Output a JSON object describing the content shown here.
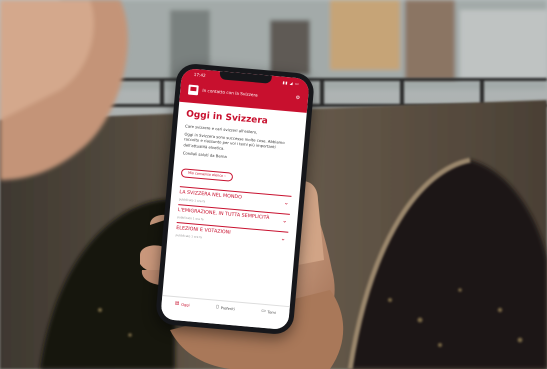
{
  "colors": {
    "brand": "#c8102e",
    "brand_light": "#ffffff",
    "text": "#333333"
  },
  "status": {
    "time": "17:42"
  },
  "header": {
    "title": "In contatto con la Svizzera",
    "logo_icon": "swissinfo-logo",
    "menu_icon": "settings-icon"
  },
  "main": {
    "title": "Oggi in Svizzera",
    "paragraphs": [
      "Care svizzere e cari svizzeri all'estero,",
      "Oggi in Svizzera sono successe molte cose. Abbiamo raccolto e riassunto per voi i temi più importanti dell'attualità elvetica.",
      "Cordiali saluti da Berna"
    ],
    "more_button": "Mio consenso elenco"
  },
  "sections": [
    {
      "title": "La Svizzera nel mondo",
      "date": "pubblicato 1 ora fa"
    },
    {
      "title": "L'emigrazione, in tutta semplicità",
      "date": "pubblicato 1 ora fa"
    },
    {
      "title": "Elezioni e votazioni",
      "date": "pubblicato 1 ora fa"
    }
  ],
  "tabs": [
    {
      "label": "Oggi",
      "icon": "news-icon",
      "active": true
    },
    {
      "label": "Preferiti",
      "icon": "bookmark-icon",
      "active": false
    },
    {
      "label": "Temi",
      "icon": "folder-icon",
      "active": false
    }
  ]
}
